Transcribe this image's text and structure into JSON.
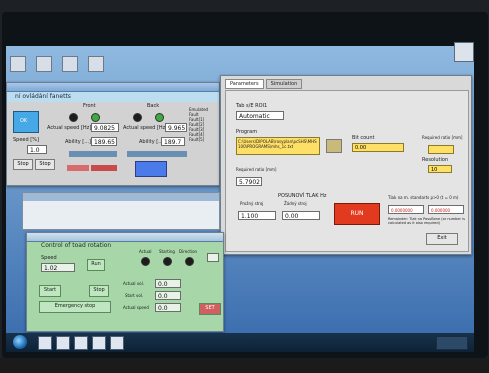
{
  "main_window": {
    "tabs": [
      "Parameters",
      "Simulation"
    ],
    "position_label": "Tab s/E ROI1",
    "position_value": "Automatic",
    "path_label": "Program",
    "path_value": "C:\\Users\\DIPOLAB\\rosyplan\\pcSHS\\MHS100\\PROGRAMS\\mhs_1c.txt",
    "meas_label": "Bit count",
    "meas_value": "0.00",
    "speed_label": "Required ratio [mm]",
    "speed_value": "5.7902",
    "resolution_label": "Resolution",
    "resolution_value": "10",
    "section_label": "POSUNOVÍ TLAK Hz",
    "tab_label1": "Prožný stroj",
    "tab_label2": "Žádný stroj",
    "value1": "1.100",
    "value2": "0.00",
    "run_button": "RUN",
    "result_title": "Tlak na m. standarts p>0 (t = 0 m)",
    "result_val1": "0.0000000",
    "result_val2": "0.000000",
    "note_text": "Remainder: Tlak na PosuBone (or number is calculated as it also required)",
    "exit_button": "Exit"
  },
  "top_left_window": {
    "title": "ní ovládání fanetts",
    "front_label": "Front",
    "back_label": "Back",
    "actual_label": "Actual speed [Hz]",
    "actual_value": "9.0825",
    "actual_value2": "9.965",
    "ratio_label": "Ability [...]",
    "ratio_value": "189.65",
    "ratio_value2": "189.7",
    "speed_label": "Speed [%]",
    "speed_value": "1.0",
    "buttons": [
      "OK",
      "Stop",
      "Stop",
      "Start"
    ],
    "legend_items": [
      "Emulated",
      "Fault",
      "Fault[1]",
      "Fault[2]",
      "Fault[3]",
      "Fault[4]",
      "Fault[5]"
    ]
  },
  "control_window": {
    "title": "Control of toad rotation",
    "speed_label": "Speed",
    "speed_value": "1.02",
    "run_label": "Run",
    "buttons": [
      "Start",
      "Stop",
      "Emergency stop",
      "SET"
    ],
    "status_labels": [
      "Actual",
      "Starting",
      "Direction"
    ],
    "field_labels": [
      "Actual vol.",
      "Start vol.",
      "Actual speed"
    ],
    "field_values": [
      "0.0",
      "0.0",
      "0.0"
    ]
  },
  "colors": {
    "wall": "#6f9ccc",
    "main_panel": "#d9d9d9",
    "yellow_field": "#ffe066",
    "red_button": "#e23a1f",
    "green_window": "#a7d7a8",
    "blue_panel": "#46a8e6"
  }
}
